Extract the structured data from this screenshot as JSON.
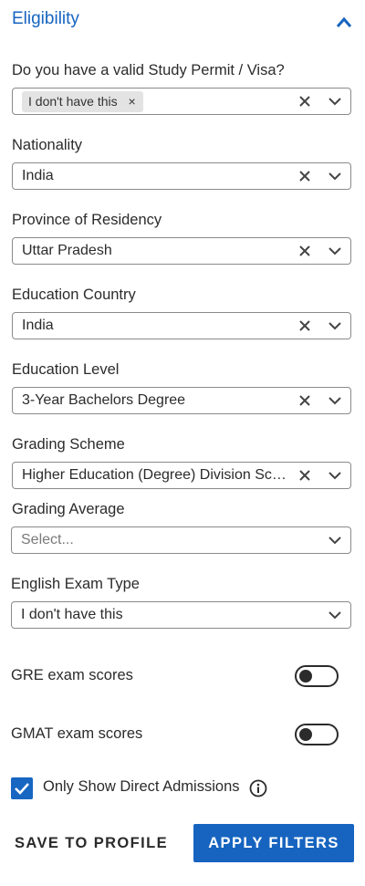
{
  "section": {
    "title": "Eligibility"
  },
  "study_permit": {
    "label": "Do you have a valid Study Permit / Visa?",
    "chip_value": "I don't have this",
    "chip_remove": "×"
  },
  "nationality": {
    "label": "Nationality",
    "value": "India"
  },
  "province": {
    "label": "Province of Residency",
    "value": "Uttar Pradesh"
  },
  "education_country": {
    "label": "Education Country",
    "value": "India"
  },
  "education_level": {
    "label": "Education Level",
    "value": "3-Year Bachelors Degree"
  },
  "grading_scheme": {
    "label": "Grading Scheme",
    "value": "Higher Education (Degree) Division Scale"
  },
  "grading_average": {
    "label": "Grading Average",
    "placeholder": "Select..."
  },
  "english_exam": {
    "label": "English Exam Type",
    "value": "I don't have this"
  },
  "toggles": {
    "gre": {
      "label": "GRE exam scores",
      "on": false
    },
    "gmat": {
      "label": "GMAT exam scores",
      "on": false
    }
  },
  "direct_admissions": {
    "label": "Only Show Direct Admissions",
    "checked": true
  },
  "buttons": {
    "save": "SAVE TO PROFILE",
    "apply": "APPLY FILTERS"
  },
  "colors": {
    "accent": "#1664c0",
    "border": "#8a8a8a",
    "chip": "#e3e3e3"
  }
}
